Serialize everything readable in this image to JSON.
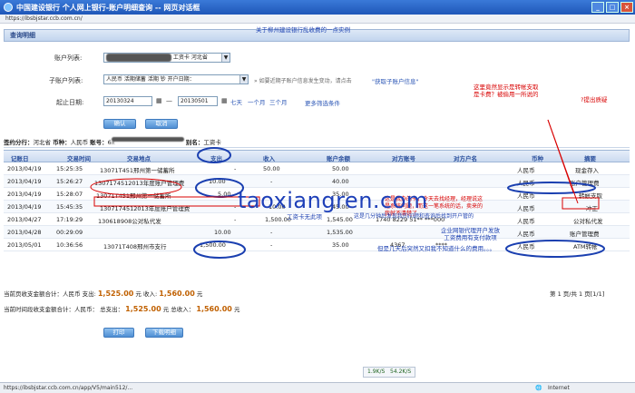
{
  "window": {
    "title": "中国建设银行 个人网上银行-账户明细查询 -- 网页对话框",
    "url": "https://ibsbjstar.ccb.com.cn/"
  },
  "page": {
    "tab_title": "查询明细",
    "notice": "关于柳州建设银行乱收费的一点实例",
    "account_label": "账户列表:",
    "account_value": "工资卡  河北省",
    "sub_account_label": "子账户列表:",
    "sub_account_value": "人民币 活期储蓄 活期 钞 开户日期：",
    "sub_account_hint": "» 如要近期子账户信息发生变动，请点击",
    "sub_account_link": "\"获取子账户信息\"",
    "date_label": "起止日期:",
    "date_from": "20130324",
    "date_sep": "—",
    "date_to": "20130501",
    "quick_7d": "七天",
    "quick_1m": "一个月",
    "quick_3m": "三个月",
    "more_conditions": "更多筛选条件",
    "confirm_btn": "确认",
    "cancel_btn": "取消"
  },
  "info": {
    "branch_label": "签约分行：",
    "branch_value": "河北省",
    "currency_label": "币种：",
    "currency_value": "人民币",
    "account_no_label": "账号：",
    "account_no_value": "6",
    "alias_label": "别名：",
    "alias_value": "工资卡"
  },
  "table": {
    "headers": [
      "记账日",
      "交易时间",
      "交易地点",
      "支出",
      "收入",
      "账户余额",
      "对方账号",
      "对方户名",
      "币种",
      "摘要"
    ],
    "rows": [
      {
        "date": "2013/04/19",
        "time": "15:25:35",
        "place": "13071T451邢州第一储蓄所",
        "out": "-",
        "in": "50.00",
        "bal": "50.00",
        "acct": "",
        "name": "",
        "cur": "人民币",
        "memo": "现金存入"
      },
      {
        "date": "2013/04/19",
        "time": "15:26:27",
        "place": "1307174512013年度账户管理费",
        "out": "10.00",
        "in": "-",
        "bal": "40.00",
        "acct": "",
        "name": "",
        "cur": "人民币",
        "memo": "账户管理费"
      },
      {
        "date": "2013/04/19",
        "time": "15:28:07",
        "place": "13071T451邢州第一储蓄所",
        "out": "5.00",
        "in": "",
        "bal": "35.00",
        "acct": "",
        "name": "",
        "cur": "人民币",
        "memo": "转帐支取"
      },
      {
        "date": "2013/04/19",
        "time": "15:45:35",
        "place": "1307174512013年度账户管理费",
        "out": "-",
        "in": "10.00",
        "bal": "45.00",
        "acct": "",
        "name": "",
        "cur": "人民币",
        "memo": "冲正"
      },
      {
        "date": "2013/04/27",
        "time": "17:19:29",
        "place": "130618908公对私代发",
        "out": "-",
        "in": "1,500.00",
        "bal": "1,545.00",
        "acct": "1740 8229 51** ***000",
        "name": "",
        "cur": "人民币",
        "memo": "公对私代发"
      },
      {
        "date": "2013/04/28",
        "time": "00:29:09",
        "place": "",
        "out": "10.00",
        "in": "-",
        "bal": "1,535.00",
        "acct": "",
        "name": "",
        "cur": "人民币",
        "memo": "账户管理费"
      },
      {
        "date": "2013/05/01",
        "time": "10:36:56",
        "place": "13071T408邢州市支行",
        "out": "1,500.00",
        "in": "-",
        "bal": "35.00",
        "acct": "4367",
        "name": "****",
        "cur": "人民币",
        "memo": "ATM转帐"
      }
    ]
  },
  "summary": {
    "page_label": "当前页收支金额合计：人民币",
    "out_label": "支出:",
    "page_out": "1,525.00",
    "in_label": "收入:",
    "page_in": "1,560.00",
    "unit": "元",
    "pager": "第 1 页/共 1 页[1/1]",
    "total_label": "当前时间段收支金额合计：人民币：",
    "total_out_label": "总支出：",
    "total_out": "1,525.00",
    "total_in_label": "总收入：",
    "total_in": "1,560.00"
  },
  "buttons": {
    "print": "打印",
    "download": "下载明细"
  },
  "annotations": {
    "a1": "这里竟然显示是转帐支取\n是卡费？被偷用一所说的",
    "a2": "?提出质疑",
    "a3": "这是我办的卡，今天去找经理，经理说这\n是系统问题，而这一笔系统的话，卖来的\n我就不清楚了",
    "a4": "工资卡无此项",
    "a5": "这是几分钟后发现我的问题和查询后找到开户管的",
    "a6": "企业网银代理开户发放\n工资费用有支付款项",
    "a7": "但是几天后突然又扣我不知道什么的费用。。。"
  },
  "watermark": "taoxiangren.com",
  "status": {
    "url": "https://ibsbjstar.ccb.com.cn/app/V5/main512/...",
    "zone": "Internet",
    "dl_speed": "1.9K/S",
    "ul_speed": "54.2K/S"
  },
  "colors": {
    "accent": "#1f57b8",
    "annotation_red": "#d80000",
    "annotation_blue": "#1a3fb0"
  }
}
